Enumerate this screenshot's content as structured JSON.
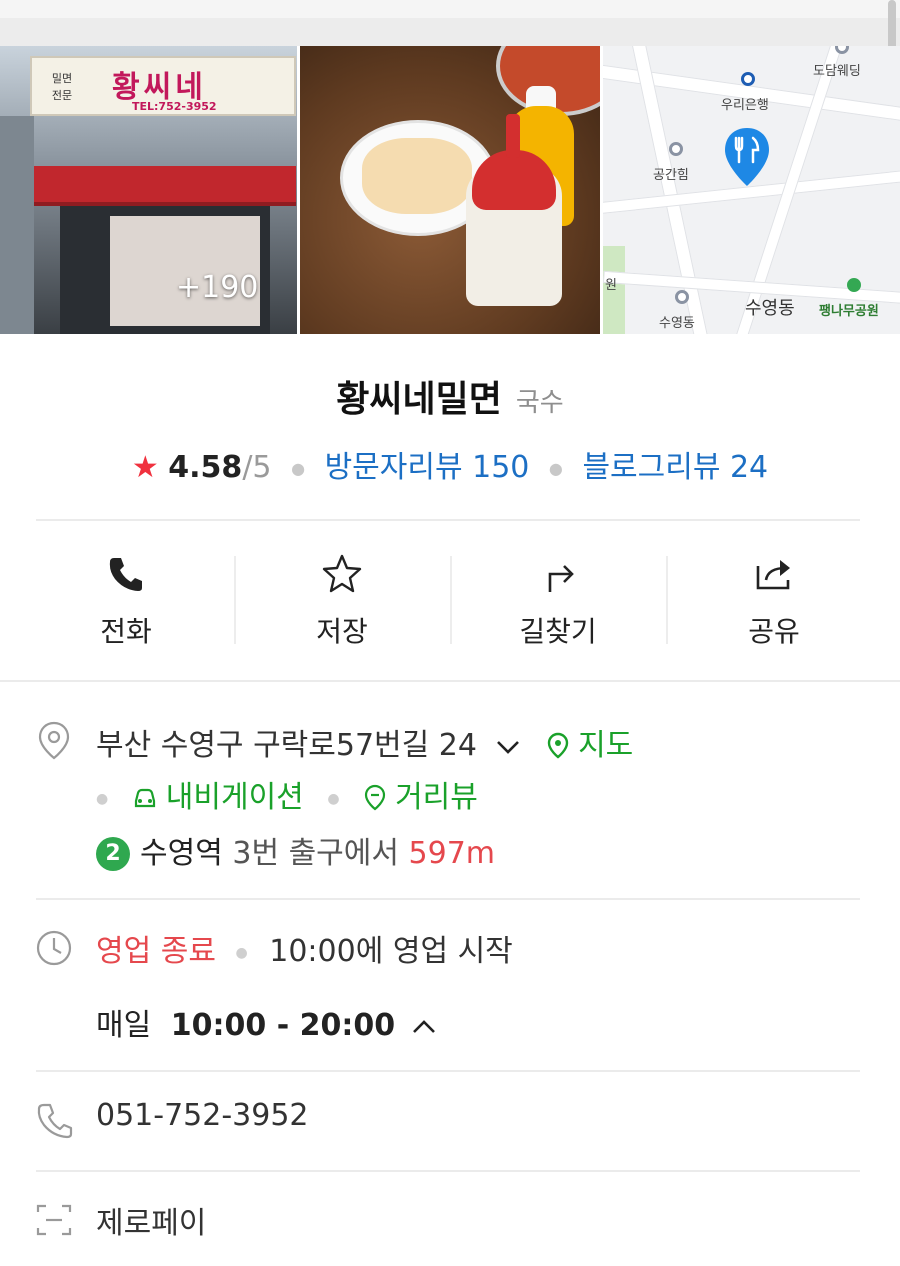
{
  "photos": {
    "more_count": "+190",
    "storefront_sign": "황씨네",
    "storefront_sign_side": "밀면\n전문",
    "storefront_tel": "TEL:752-3952"
  },
  "map": {
    "labels": [
      "도담웨딩",
      "우리은행",
      "공간힘",
      "수영동",
      "팽나무공원",
      "원",
      "수영동"
    ],
    "pin_icon": "fork-knife-icon"
  },
  "place": {
    "name": "황씨네밀면",
    "category": "국수",
    "rating_star": "★",
    "rating": "4.58",
    "rating_max": "/5",
    "visitor_reviews": "방문자리뷰 150",
    "blog_reviews": "블로그리뷰 24"
  },
  "actions": [
    {
      "label": "전화",
      "icon": "phone-icon"
    },
    {
      "label": "저장",
      "icon": "star-outline-icon"
    },
    {
      "label": "길찾기",
      "icon": "route-icon"
    },
    {
      "label": "공유",
      "icon": "share-icon"
    }
  ],
  "address": {
    "text": "부산 수영구 구락로57번길 24",
    "map_link": "지도",
    "navigation_link": "내비게이션",
    "street_view_link": "거리뷰",
    "subway_line": "2",
    "subway_station": "수영역",
    "subway_exit": "3번 출구에서",
    "distance": "597m"
  },
  "hours": {
    "status": "영업 종료",
    "next_open": "10:00에 영업 시작",
    "days": "매일",
    "range": "10:00 - 20:00"
  },
  "phone": {
    "number": "051-752-3952"
  },
  "payment": {
    "label": "제로페이"
  },
  "colors": {
    "accent_red": "#e5484d",
    "link_blue": "#1c6fc4",
    "accent_green": "#1aa12a",
    "star_red": "#f0313e",
    "subway_line_2": "#2fa84f"
  }
}
